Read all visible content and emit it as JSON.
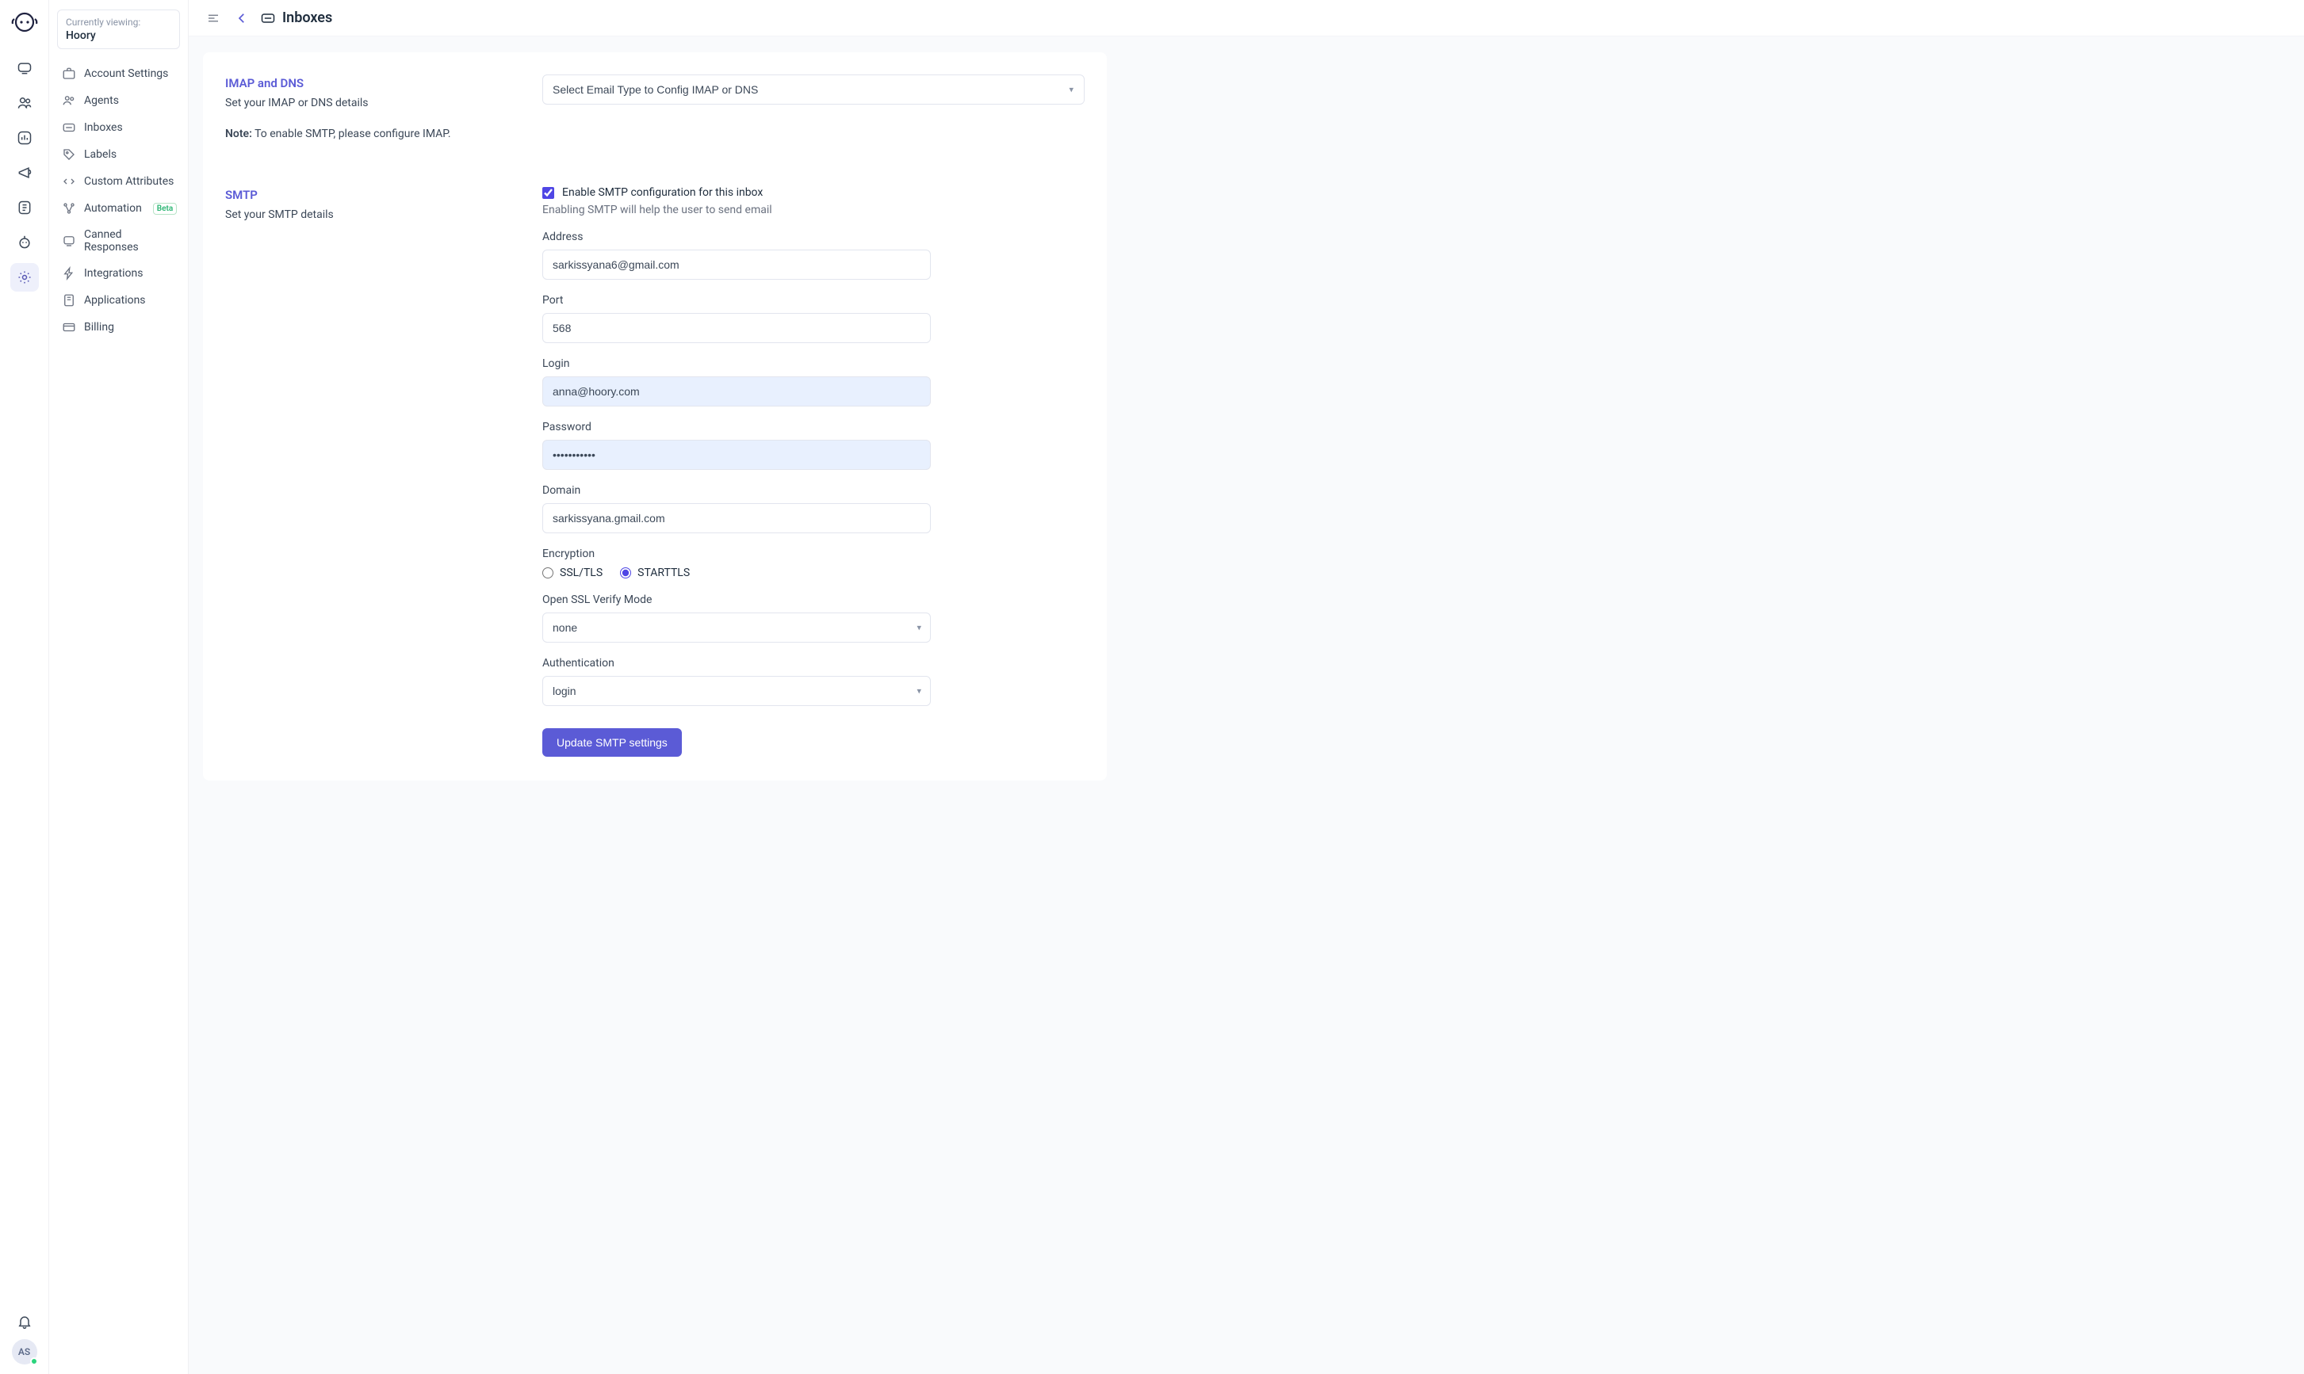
{
  "viewing": {
    "label": "Currently viewing:",
    "name": "Hoory"
  },
  "sidebar": {
    "items": [
      {
        "label": "Account Settings"
      },
      {
        "label": "Agents"
      },
      {
        "label": "Inboxes"
      },
      {
        "label": "Labels"
      },
      {
        "label": "Custom Attributes"
      },
      {
        "label": "Automation",
        "beta": "Beta"
      },
      {
        "label": "Canned Responses"
      },
      {
        "label": "Integrations"
      },
      {
        "label": "Applications"
      },
      {
        "label": "Billing"
      }
    ]
  },
  "header": {
    "title": "Inboxes"
  },
  "avatar": "AS",
  "imap": {
    "title": "IMAP and DNS",
    "desc": "Set your IMAP or DNS details",
    "note_bold": "Note:",
    "note_rest": " To enable SMTP, please configure IMAP.",
    "select_placeholder": "Select Email Type to Config IMAP or DNS"
  },
  "smtp": {
    "title": "SMTP",
    "desc": "Set your SMTP details",
    "enable_label": "Enable SMTP configuration for this inbox",
    "enable_helper": "Enabling SMTP will help the user to send email",
    "address_label": "Address",
    "address_value": "sarkissyana6@gmail.com",
    "port_label": "Port",
    "port_value": "568",
    "login_label": "Login",
    "login_value": "anna@hoory.com",
    "password_label": "Password",
    "password_value": "•••••••••••",
    "domain_label": "Domain",
    "domain_value": "sarkissyana.gmail.com",
    "encryption_label": "Encryption",
    "encryption_options": [
      "SSL/TLS",
      "STARTTLS"
    ],
    "ssl_verify_label": "Open SSL Verify Mode",
    "ssl_verify_value": "none",
    "auth_label": "Authentication",
    "auth_value": "login",
    "submit": "Update SMTP settings"
  }
}
